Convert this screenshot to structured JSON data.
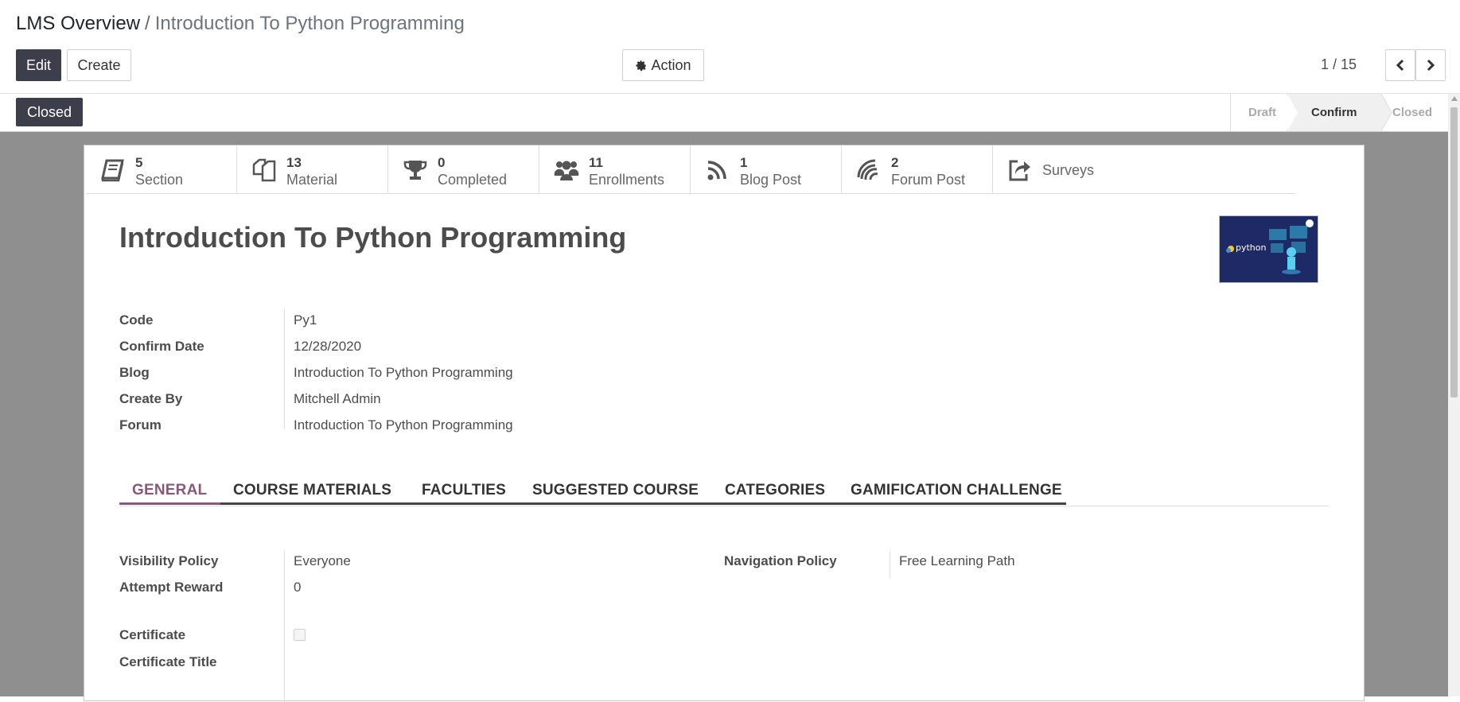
{
  "breadcrumb": {
    "parent": "LMS Overview",
    "separator": "/",
    "current": "Introduction To Python Programming"
  },
  "buttons": {
    "edit": "Edit",
    "create": "Create",
    "action": "Action"
  },
  "pager": {
    "value": "1 / 15"
  },
  "status": {
    "button": "Closed",
    "stages": [
      "Draft",
      "Confirm",
      "Closed"
    ],
    "current_stage": "Confirm"
  },
  "smart_buttons": [
    {
      "value": "5",
      "label": "Section",
      "icon": "book-icon"
    },
    {
      "value": "13",
      "label": "Material",
      "icon": "copy-icon"
    },
    {
      "value": "0",
      "label": "Completed",
      "icon": "trophy-icon"
    },
    {
      "value": "11",
      "label": "Enrollments",
      "icon": "users-icon"
    },
    {
      "value": "1",
      "label": "Blog Post",
      "icon": "rss-icon"
    },
    {
      "value": "2",
      "label": "Forum Post",
      "icon": "feed-icon"
    },
    {
      "value": "",
      "label": "Surveys",
      "icon": "share-icon"
    }
  ],
  "record": {
    "title": "Introduction To Python Programming",
    "image_text": "python",
    "fields": [
      {
        "label": "Code",
        "value": "Py1"
      },
      {
        "label": "Confirm Date",
        "value": "12/28/2020"
      },
      {
        "label": "Blog",
        "value": "Introduction To Python Programming"
      },
      {
        "label": "Create By",
        "value": "Mitchell Admin"
      },
      {
        "label": "Forum",
        "value": "Introduction To Python Programming"
      }
    ]
  },
  "tabs": [
    "GENERAL",
    "COURSE MATERIALS",
    "FACULTIES",
    "SUGGESTED COURSE",
    "CATEGORIES",
    "GAMIFICATION CHALLENGE"
  ],
  "general": {
    "visibility_policy": {
      "label": "Visibility Policy",
      "value": "Everyone"
    },
    "navigation_policy": {
      "label": "Navigation Policy",
      "value": "Free Learning Path"
    },
    "attempt_reward": {
      "label": "Attempt Reward",
      "value": "0"
    },
    "certificate": {
      "label": "Certificate",
      "checked": false
    },
    "certificate_title": {
      "label": "Certificate Title",
      "value": ""
    }
  },
  "colors": {
    "primary": "#875a7b",
    "dark_button": "#3c3e4b",
    "sheet_background": "#8f8f8f"
  }
}
